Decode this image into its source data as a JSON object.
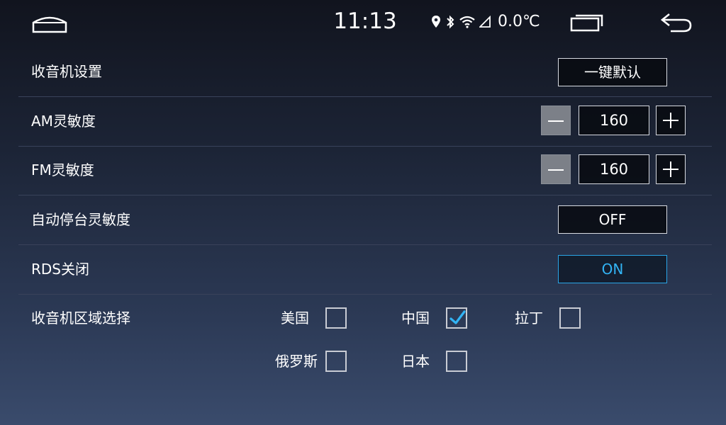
{
  "status_bar": {
    "time": "11:13",
    "temperature": "0.0℃",
    "icons": [
      "home-icon",
      "location-icon",
      "bluetooth-icon",
      "wifi-icon",
      "signal-icon",
      "recent-apps-icon",
      "back-icon"
    ]
  },
  "settings": {
    "radio_settings": {
      "label": "收音机设置",
      "button": "一键默认"
    },
    "am_sensitivity": {
      "label": "AM灵敏度",
      "value": "160"
    },
    "fm_sensitivity": {
      "label": "FM灵敏度",
      "value": "160"
    },
    "auto_stop_sensitivity": {
      "label": "自动停台灵敏度",
      "button": "OFF"
    },
    "rds_close": {
      "label": "RDS关闭",
      "button": "ON"
    }
  },
  "region": {
    "label": "收音机区域选择",
    "options": [
      {
        "label": "美国",
        "checked": false
      },
      {
        "label": "中国",
        "checked": true
      },
      {
        "label": "拉丁",
        "checked": false
      },
      {
        "label": "俄罗斯",
        "checked": false
      },
      {
        "label": "日本",
        "checked": false
      }
    ]
  },
  "colors": {
    "accent": "#32b4f5",
    "row_divider": "#39425a",
    "stepper_minus_bg": "#7c8088"
  }
}
